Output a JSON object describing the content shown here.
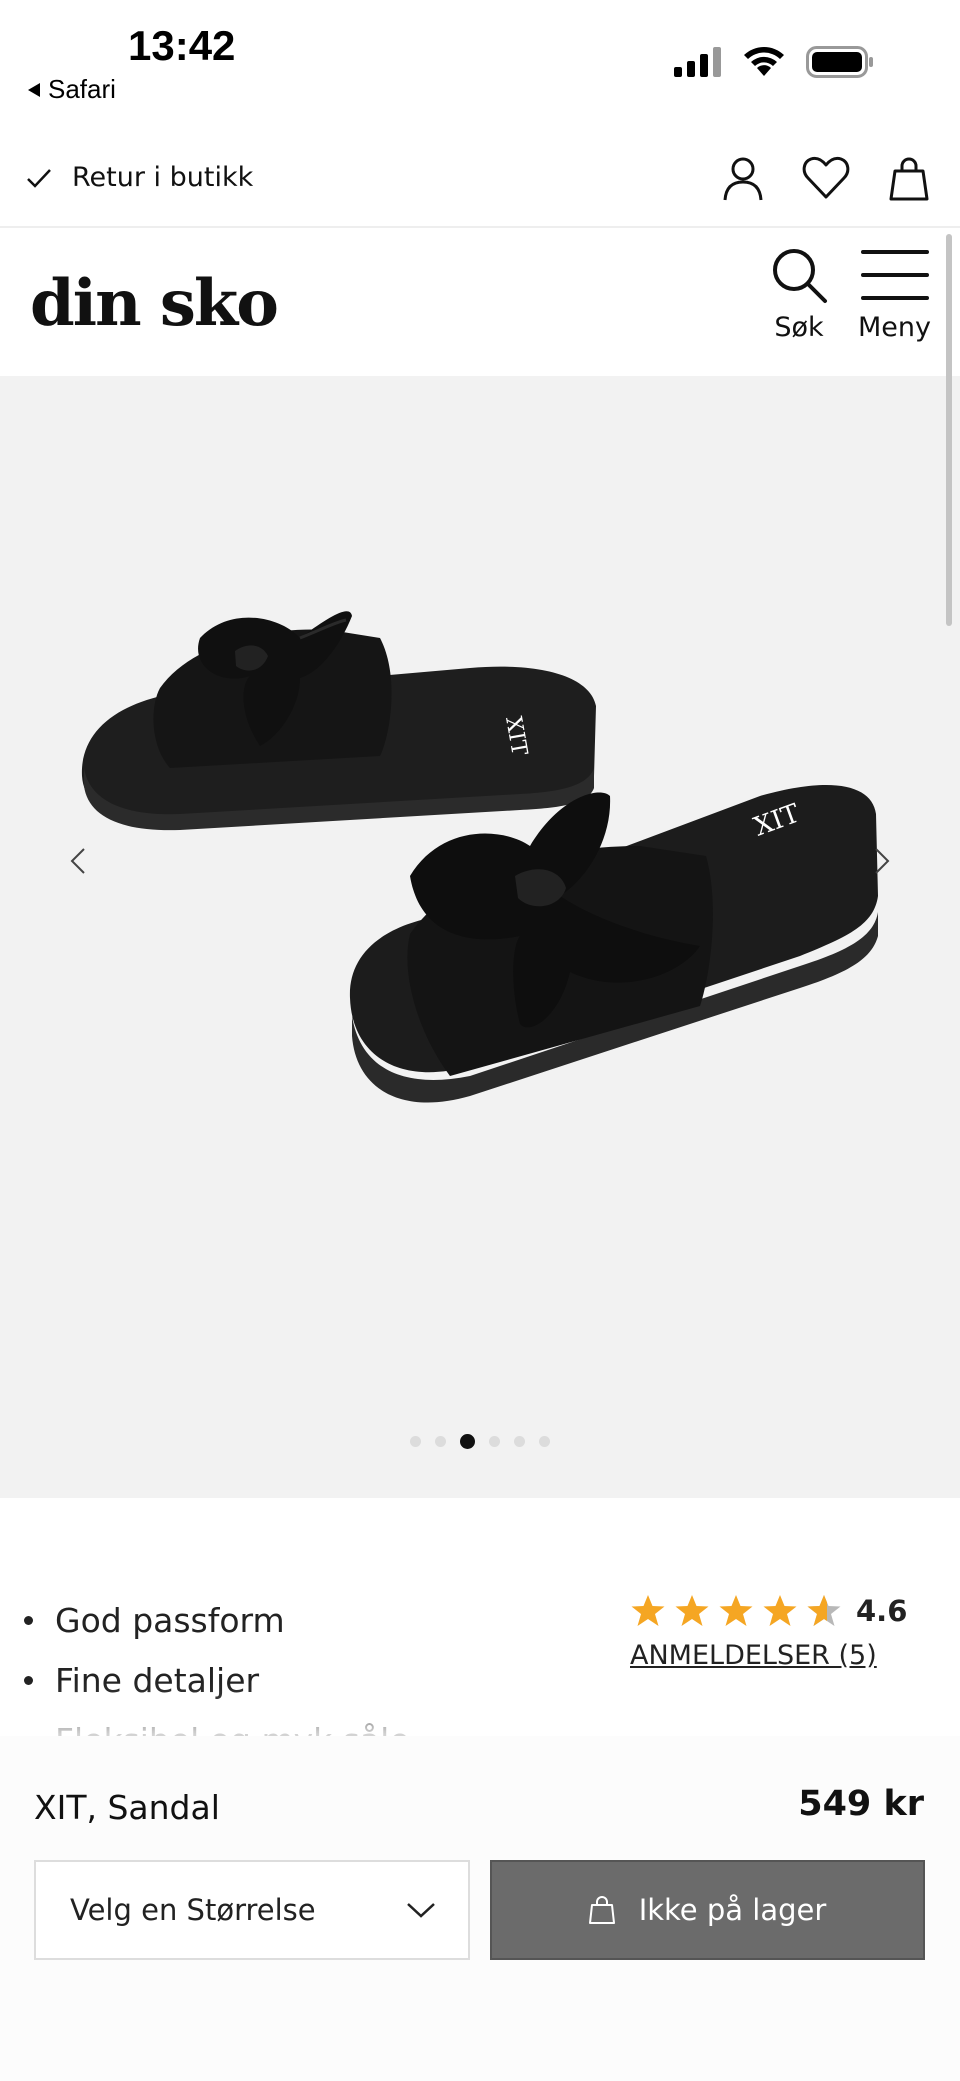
{
  "status_bar": {
    "time": "13:42",
    "back_app": "Safari",
    "icons": [
      "cellular-signal-icon",
      "wifi-icon",
      "battery-icon"
    ]
  },
  "utility_bar": {
    "retur_label": "Retur i butikk",
    "icons": [
      "account-icon",
      "wishlist-heart-icon",
      "shopping-bag-icon"
    ]
  },
  "header": {
    "logo": "din sko",
    "search_label": "Søk",
    "menu_label": "Meny"
  },
  "gallery": {
    "image": "black-bow-slide-sandals",
    "image_brand_mark": "XIT",
    "slide_count": 6,
    "active_slide": 3
  },
  "features": [
    "God passform",
    "Fine detaljer",
    "Fleksibel og myk såle"
  ],
  "rating": {
    "value": "4.6",
    "stars": 4.6,
    "reviews_label": "ANMELDELSER (5)",
    "star_color": "#f5a623"
  },
  "purchase": {
    "product_name": "XIT, Sandal",
    "price": "549 kr",
    "size_placeholder": "Velg en Størrelse",
    "stock_button_label": "Ikke på lager",
    "button_color": "#6b6b6b"
  }
}
